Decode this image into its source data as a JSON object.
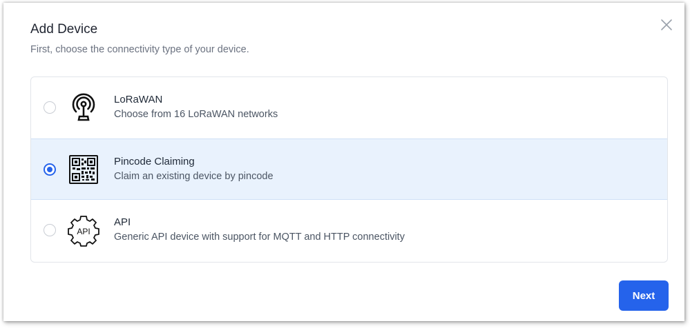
{
  "dialog": {
    "title": "Add Device",
    "subtitle": "First, choose the connectivity type of your device.",
    "close_icon": "close-icon",
    "next_label": "Next"
  },
  "options": [
    {
      "title": "LoRaWAN",
      "description": "Choose from 16 LoRaWAN networks",
      "icon": "antenna-icon",
      "selected": false
    },
    {
      "title": "Pincode Claiming",
      "description": "Claim an existing device by pincode",
      "icon": "qr-code-icon",
      "selected": true
    },
    {
      "title": "API",
      "description": "Generic API device with support for MQTT and HTTP connectivity",
      "icon": "api-gear-icon",
      "selected": false
    }
  ],
  "colors": {
    "accent": "#2563eb",
    "selected_bg": "#e9f2fd",
    "border": "#e2e5ea"
  }
}
